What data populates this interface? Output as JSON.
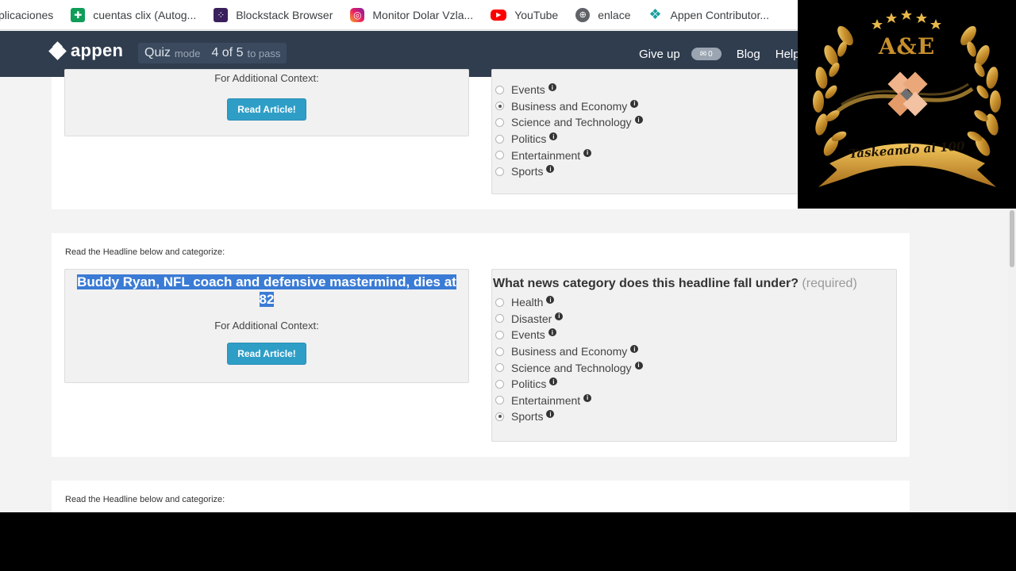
{
  "bookmarks": [
    {
      "label": "plicaciones",
      "icon": "none"
    },
    {
      "label": "cuentas clix (Autog...",
      "icon": "google-sheets-icon"
    },
    {
      "label": "Blockstack Browser",
      "icon": "blockstack-icon"
    },
    {
      "label": "Monitor Dolar Vzla...",
      "icon": "instagram-icon"
    },
    {
      "label": "YouTube",
      "icon": "youtube-icon"
    },
    {
      "label": "enlace",
      "icon": "globe-icon"
    },
    {
      "label": "Appen Contributor...",
      "icon": "appen-icon"
    }
  ],
  "header": {
    "logo": "appen",
    "quiz_label": "Quiz",
    "mode_label": "mode",
    "progress": "4 of 5",
    "progress_suffix": "to pass",
    "give_up": "Give up",
    "messages_count": "0",
    "blog": "Blog",
    "help": "Help"
  },
  "cards": [
    {
      "headline": "",
      "context": "For Additional Context:",
      "read_button": "Read Article!",
      "options": [
        {
          "label": "Events",
          "selected": false
        },
        {
          "label": "Business and Economy",
          "selected": true
        },
        {
          "label": "Science and Technology",
          "selected": false
        },
        {
          "label": "Politics",
          "selected": false
        },
        {
          "label": "Entertainment",
          "selected": false
        },
        {
          "label": "Sports",
          "selected": false
        }
      ]
    },
    {
      "instruction": "Read the Headline below and categorize:",
      "headline": "Buddy Ryan, NFL coach and defensive mastermind, dies at 82",
      "context": "For Additional Context:",
      "read_button": "Read Article!",
      "question": "What news category does this headline fall under?",
      "required": "(required)",
      "options": [
        {
          "label": "Health",
          "selected": false
        },
        {
          "label": "Disaster",
          "selected": false
        },
        {
          "label": "Events",
          "selected": false
        },
        {
          "label": "Business and Economy",
          "selected": false
        },
        {
          "label": "Science and Technology",
          "selected": false
        },
        {
          "label": "Politics",
          "selected": false
        },
        {
          "label": "Entertainment",
          "selected": false
        },
        {
          "label": "Sports",
          "selected": true
        }
      ]
    },
    {
      "instruction": "Read the Headline below and categorize:"
    }
  ],
  "overlay": {
    "monogram": "A&E",
    "banner": "Taskeando al 100"
  },
  "colors": {
    "appbar": "#303d4f",
    "button": "#2f9ec7",
    "selection": "#3a7bd5",
    "gold": "#d4a23a"
  }
}
